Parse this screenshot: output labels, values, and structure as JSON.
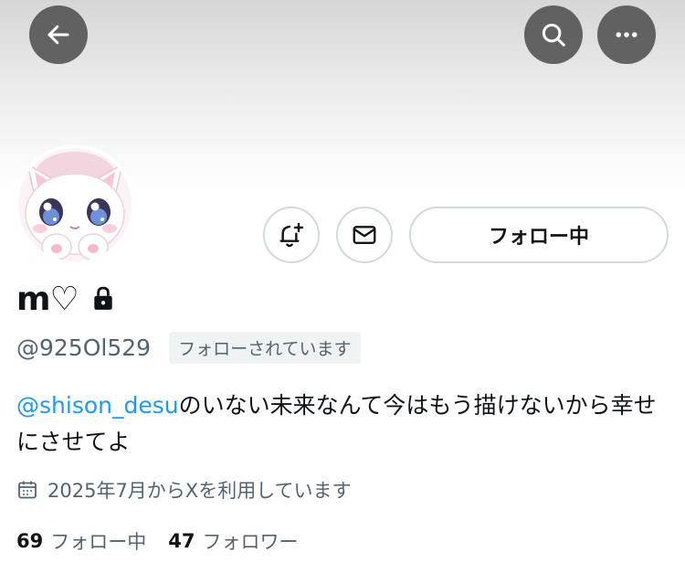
{
  "header": {
    "back_icon": "arrow-left-icon",
    "search_icon": "search-icon",
    "more_icon": "more-horizontal-icon"
  },
  "profile": {
    "avatar_icon": "cat-avatar-image",
    "display_name": "m♡",
    "protected_icon": "lock-icon",
    "handle": "@925Ol529",
    "follows_you_label": "フォローされています",
    "bio_mention": "@shison_desu",
    "bio_text": "のいない未来なんて今はもう描けないから幸せにさせてよ",
    "joined_icon": "calendar-icon",
    "joined_text": "2025年7月からXを利用しています"
  },
  "actions": {
    "notify_icon": "bell-plus-icon",
    "message_icon": "mail-icon",
    "follow_label": "フォロー中"
  },
  "stats": {
    "following_count": "69",
    "following_label": "フォロー中",
    "followers_count": "47",
    "followers_label": "フォロワー"
  },
  "colors": {
    "accent": "#1d9bf0",
    "text_primary": "#0f1419",
    "text_secondary": "#536471",
    "border": "#cfd9de"
  }
}
